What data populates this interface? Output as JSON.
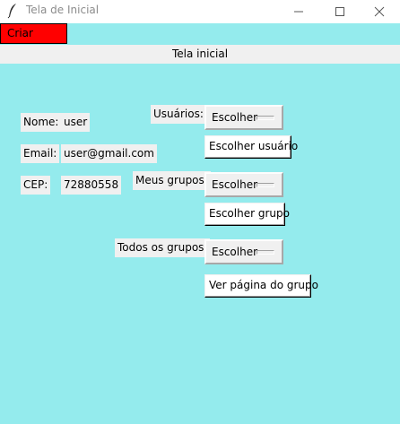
{
  "window": {
    "title": "Tela de Inicial",
    "icon": "feather-icon",
    "controls": [
      "minimize-icon",
      "maximize-icon",
      "close-icon"
    ]
  },
  "toolbar": {
    "criar_grupo_label": "Criar grupo"
  },
  "header": {
    "title": "Tela inicial"
  },
  "profile": {
    "nome_label": "Nome:",
    "nome_value": "user",
    "email_label": "Email:",
    "email_value": "user@gmail.com",
    "cep_label": "CEP:",
    "cep_value": "72880558"
  },
  "usuarios": {
    "label": "Usuários:",
    "selected": "Escolher",
    "button": "Escolher usuário"
  },
  "meus_grupos": {
    "label": "Meus grupos:",
    "selected": "Escolher",
    "button": "Escolher grupo"
  },
  "todos_grupos": {
    "label": "Todos os grupos:",
    "selected": "Escolher",
    "button": "Ver página do grupo"
  },
  "colors": {
    "background": "#94ebed",
    "criar_grupo_bg": "#ff0000",
    "header_bg": "#f0f0f0"
  }
}
